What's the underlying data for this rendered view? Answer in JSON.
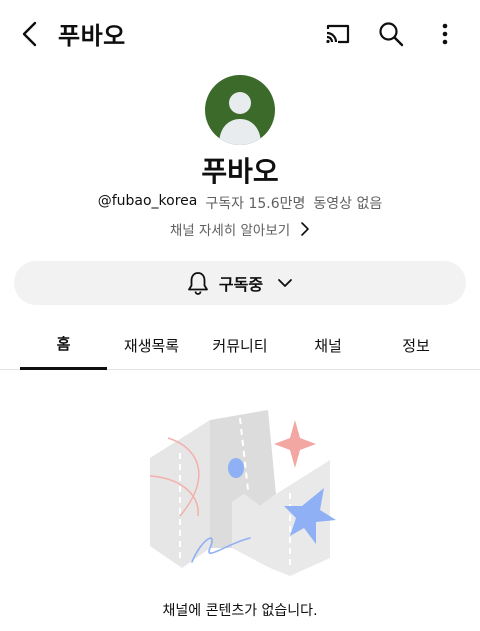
{
  "topbar": {
    "title": "푸바오"
  },
  "channel": {
    "name": "푸바오",
    "handle": "@fubao_korea",
    "subscribers": "구독자 15.6만명",
    "videos": "동영상 없음",
    "about_link": "채널 자세히 알아보기",
    "avatar_color": "#3c6a2a"
  },
  "subscribe": {
    "label": "구독중"
  },
  "tabs": [
    {
      "label": "홈",
      "active": true
    },
    {
      "label": "재생목록",
      "active": false
    },
    {
      "label": "커뮤니티",
      "active": false
    },
    {
      "label": "채널",
      "active": false
    },
    {
      "label": "정보",
      "active": false
    }
  ],
  "empty_state": {
    "message": "채널에 콘텐츠가 없습니다."
  },
  "colors": {
    "text_primary": "#0f0f0f",
    "text_secondary": "#606060",
    "button_bg": "#f2f2f2",
    "accent_red": "#f2a7a2",
    "accent_blue": "#8fb0f5"
  }
}
